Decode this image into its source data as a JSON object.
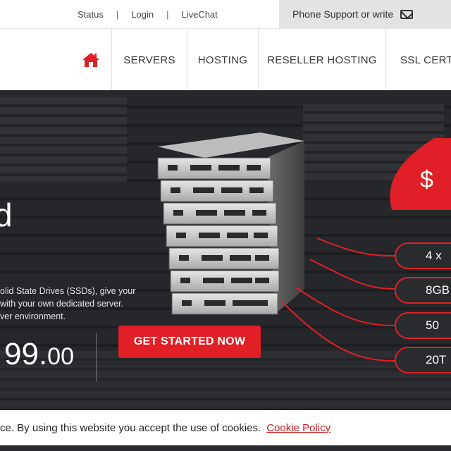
{
  "topbar": {
    "links": [
      "Status",
      "Login",
      "LiveChat"
    ],
    "separator": "|",
    "support_text": "Phone Support or write",
    "support_icon": "envelope-icon"
  },
  "nav": {
    "home_icon": "home-icon",
    "items": [
      "SERVERS",
      "HOSTING",
      "RESELLER HOSTING",
      "SSL CERTI"
    ]
  },
  "hero": {
    "title_partial": "d",
    "description_lines": [
      "olid State Drives (SSDs), give your",
      "with your own dedicated server.",
      "ver environment."
    ],
    "price_main": "99.",
    "price_cents": "00",
    "cta_label": "GET STARTED NOW",
    "badge_text": "$",
    "specs": [
      "4 x",
      "8GB",
      "50",
      "20T"
    ]
  },
  "cookie": {
    "text": "ce. By using this website you accept the use of cookies.",
    "link_label": "Cookie Policy"
  },
  "colors": {
    "accent_red": "#e01f26",
    "dark_bg": "#2a2b2e",
    "nav_text": "#3a3a3a"
  }
}
